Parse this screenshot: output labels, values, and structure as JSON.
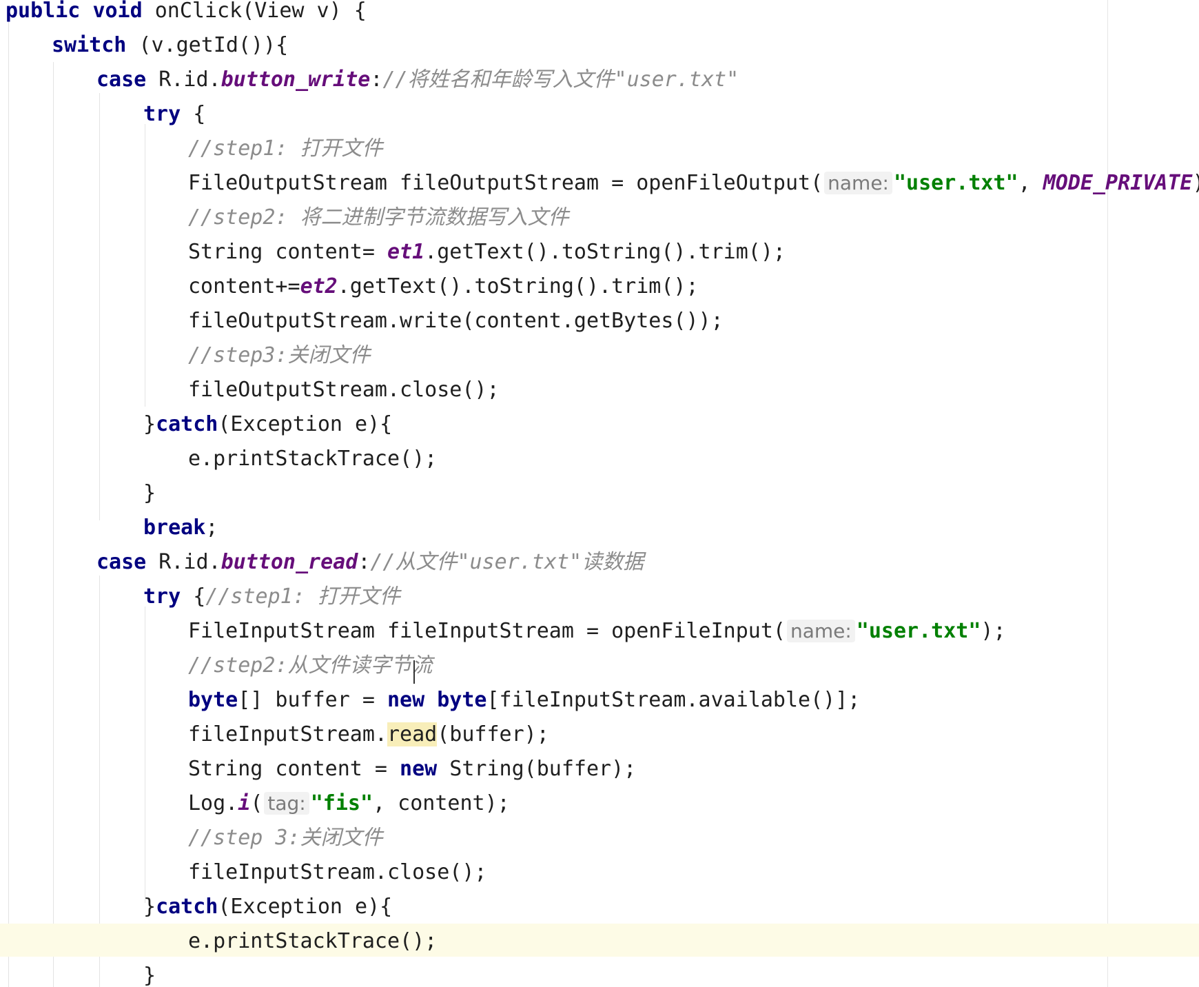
{
  "editor": {
    "lines": [
      [
        {
          "t": "public",
          "c": "kw"
        },
        {
          "t": " "
        },
        {
          "t": "void",
          "c": "kw"
        },
        {
          "t": " onClick(View v) {"
        }
      ],
      [
        {
          "t": "switch",
          "c": "kw"
        },
        {
          "t": " (v.getId()){"
        }
      ],
      [
        {
          "t": "case",
          "c": "kw"
        },
        {
          "t": " R.id."
        },
        {
          "t": "button_write",
          "c": "field"
        },
        {
          "t": ":"
        },
        {
          "t": "//将姓名和年龄写入文件\"user.txt\"",
          "c": "cmt"
        }
      ],
      [
        {
          "t": "try",
          "c": "kw"
        },
        {
          "t": " {"
        }
      ],
      [
        {
          "t": "//step1: 打开文件",
          "c": "cmt"
        }
      ],
      [
        {
          "t": "FileOutputStream fileOutputStream = openFileOutput("
        },
        {
          "t": "name:",
          "c": "hint"
        },
        {
          "t": "\"user.txt\"",
          "c": "str"
        },
        {
          "t": ", "
        },
        {
          "t": "MODE_PRIVATE",
          "c": "field"
        },
        {
          "t": ");"
        }
      ],
      [
        {
          "t": "//step2: 将二进制字节流数据写入文件",
          "c": "cmt"
        }
      ],
      [
        {
          "t": "String content= "
        },
        {
          "t": "et1",
          "c": "field"
        },
        {
          "t": ".getText().toString().trim();"
        }
      ],
      [
        {
          "t": "content+="
        },
        {
          "t": "et2",
          "c": "field"
        },
        {
          "t": ".getText().toString().trim();"
        }
      ],
      [
        {
          "t": "fileOutputStream.write(content.getBytes());"
        }
      ],
      [
        {
          "t": "//step3:关闭文件",
          "c": "cmt"
        }
      ],
      [
        {
          "t": "fileOutputStream.close();"
        }
      ],
      [
        {
          "t": "}"
        },
        {
          "t": "catch",
          "c": "kw"
        },
        {
          "t": "(Exception e){"
        }
      ],
      [
        {
          "t": "e.printStackTrace();"
        }
      ],
      [
        {
          "t": "}"
        }
      ],
      [
        {
          "t": "break",
          "c": "kw"
        },
        {
          "t": ";"
        }
      ],
      [
        {
          "t": "case",
          "c": "kw"
        },
        {
          "t": " R.id."
        },
        {
          "t": "button_read",
          "c": "field"
        },
        {
          "t": ":"
        },
        {
          "t": "//从文件\"user.txt\"读数据",
          "c": "cmt"
        }
      ],
      [
        {
          "t": "try",
          "c": "kw"
        },
        {
          "t": " {"
        },
        {
          "t": "//step1: 打开文件",
          "c": "cmt"
        }
      ],
      [
        {
          "t": "FileInputStream fileInputStream = openFileInput("
        },
        {
          "t": "name:",
          "c": "hint"
        },
        {
          "t": "\"user.txt\"",
          "c": "str"
        },
        {
          "t": ");"
        }
      ],
      [
        {
          "t": "//step2:从文件读字节流",
          "c": "cmt"
        }
      ],
      [
        {
          "t": "byte",
          "c": "kw"
        },
        {
          "t": "[] buffer = "
        },
        {
          "t": "new",
          "c": "kw"
        },
        {
          "t": " "
        },
        {
          "t": "byte",
          "c": "kw"
        },
        {
          "t": "[fileInputStream.available()];"
        }
      ],
      [
        {
          "t": "fileInputStream."
        },
        {
          "t": "read",
          "c": "hl"
        },
        {
          "t": "(buffer);"
        }
      ],
      [
        {
          "t": "String content = "
        },
        {
          "t": "new",
          "c": "kw"
        },
        {
          "t": " String(buffer);"
        }
      ],
      [
        {
          "t": "Log."
        },
        {
          "t": "i",
          "c": "field"
        },
        {
          "t": "("
        },
        {
          "t": "tag:",
          "c": "hint"
        },
        {
          "t": "\"fis\"",
          "c": "str"
        },
        {
          "t": ", content);"
        }
      ],
      [
        {
          "t": "//step 3:关闭文件",
          "c": "cmt"
        }
      ],
      [
        {
          "t": "fileInputStream.close();"
        }
      ],
      [
        {
          "t": "}"
        },
        {
          "t": "catch",
          "c": "kw"
        },
        {
          "t": "(Exception e){"
        }
      ],
      [
        {
          "t": "e.printStackTrace();"
        }
      ],
      [
        {
          "t": "}"
        }
      ]
    ]
  }
}
